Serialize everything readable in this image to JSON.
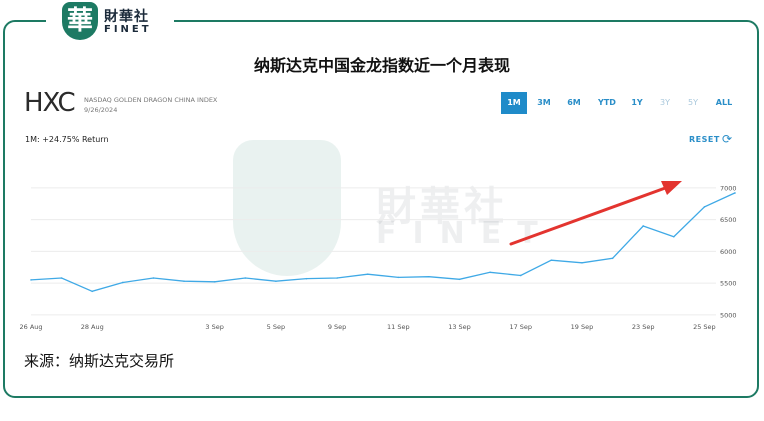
{
  "logo": {
    "badge_char": "華",
    "name_cn": "財華社",
    "name_en": "FINET"
  },
  "watermark": {
    "badge_char": "華",
    "name_cn": "財華社",
    "name_en": "FINET"
  },
  "title": "纳斯达克中国金龙指数近一个月表现",
  "widget": {
    "symbol": "HXC",
    "index_name": "NASDAQ GOLDEN DRAGON CHINA INDEX",
    "date": "9/26/2024",
    "return_text": "1M: +24.75% Return",
    "reset_label": "RESET",
    "reset_icon": "refresh-icon",
    "ranges": [
      {
        "label": "1M",
        "state": "active"
      },
      {
        "label": "3M",
        "state": "enabled"
      },
      {
        "label": "6M",
        "state": "enabled"
      },
      {
        "label": "YTD",
        "state": "enabled"
      },
      {
        "label": "1Y",
        "state": "enabled"
      },
      {
        "label": "3Y",
        "state": "disabled"
      },
      {
        "label": "5Y",
        "state": "disabled"
      },
      {
        "label": "ALL",
        "state": "enabled"
      }
    ]
  },
  "source": "来源：纳斯达克交易所",
  "colors": {
    "brand_green": "#1d7a63",
    "line": "#3fa9e6",
    "arrow": "#e3342f",
    "accent": "#1f8bc9"
  },
  "chart_data": {
    "type": "line",
    "title": "",
    "xlabel": "",
    "ylabel": "",
    "ylim": [
      4950,
      7250
    ],
    "y_ticks": [
      5000,
      5500,
      6000,
      6500,
      7000
    ],
    "y_tick_labels": [
      "5000",
      "5500",
      "6000",
      "6500",
      "7000"
    ],
    "x_tick_labels": [
      "26 Aug",
      "28 Aug",
      "3 Sep",
      "5 Sep",
      "9 Sep",
      "11 Sep",
      "13 Sep",
      "17 Sep",
      "19 Sep",
      "23 Sep",
      "25 Sep"
    ],
    "grid": true,
    "annotation": "red arrow pointing up-right",
    "series": [
      {
        "x": [
          "26 Aug",
          "27 Aug",
          "28 Aug",
          "29 Aug",
          "30 Aug",
          "2 Sep",
          "3 Sep",
          "4 Sep",
          "5 Sep",
          "6 Sep",
          "9 Sep",
          "10 Sep",
          "11 Sep",
          "12 Sep",
          "13 Sep",
          "16 Sep",
          "17 Sep",
          "18 Sep",
          "19 Sep",
          "20 Sep",
          "23 Sep",
          "24 Sep",
          "25 Sep",
          "26 Sep"
        ],
        "values": [
          5550,
          5580,
          5370,
          5510,
          5580,
          5530,
          5520,
          5580,
          5530,
          5570,
          5580,
          5640,
          5590,
          5600,
          5560,
          5670,
          5620,
          5860,
          5820,
          5890,
          6400,
          6230,
          6700,
          6920
        ]
      }
    ]
  }
}
